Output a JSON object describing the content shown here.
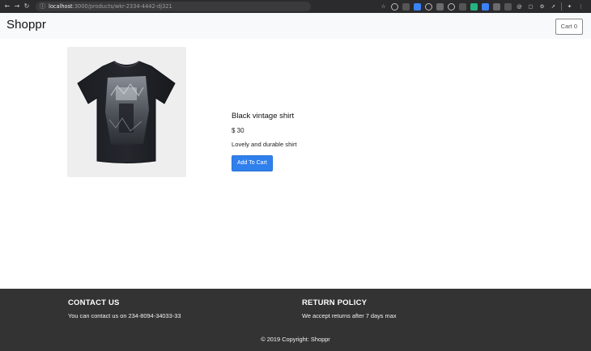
{
  "browser": {
    "url_host": "localhost",
    "url_path": ":3000/products/wkr-2334-4442-dj321",
    "back_icon": "back-arrow-icon",
    "forward_icon": "forward-arrow-icon",
    "reload_icon": "reload-icon"
  },
  "navbar": {
    "brand": "Shoppr",
    "cart_label": "Cart 0"
  },
  "product": {
    "name": "Black vintage shirt",
    "price": "$ 30",
    "description": "Lovely and durable shirt",
    "add_to_cart_label": "Add To Cart",
    "image_alt": "black vintage t-shirt"
  },
  "footer": {
    "contact_heading": "CONTACT US",
    "contact_text": "You can contact us on 234-8094-34033-33",
    "return_heading": "RETURN POLICY",
    "return_text": "We accept returns after 7 days max",
    "copyright": "© 2019 Copyright: Shoppr"
  },
  "colors": {
    "primary_button": "#2f80ed",
    "footer_bg": "#333333",
    "navbar_bg": "#f8f9fa"
  }
}
